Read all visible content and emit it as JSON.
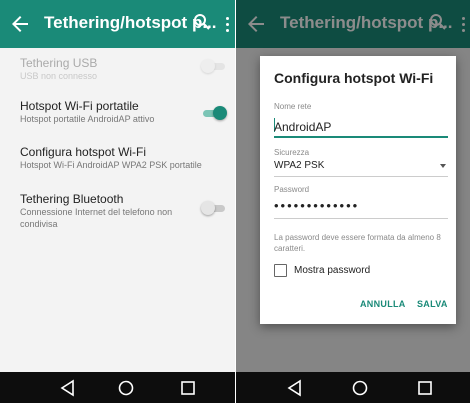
{
  "colors": {
    "accent": "#1a8a78",
    "toolbar": "#1a8a78",
    "nav_bar": "#0d0d0d"
  },
  "left": {
    "toolbar": {
      "title": "Tethering/hotspot p...",
      "back_icon": "arrow-left-icon",
      "search_icon": "search-icon",
      "more_icon": "more-vert-icon"
    },
    "items": [
      {
        "title": "Tethering USB",
        "subtitle": "USB non connesso",
        "toggle_on": false,
        "disabled": true
      },
      {
        "title": "Hotspot Wi-Fi portatile",
        "subtitle": "Hotspot portatile AndroidAP attivo",
        "toggle_on": true,
        "disabled": false
      },
      {
        "title": "Configura hotspot Wi-Fi",
        "subtitle": "Hotspot Wi-Fi AndroidAP WPA2 PSK portatile"
      },
      {
        "title": "Tethering Bluetooth",
        "subtitle": "Connessione Internet del telefono non condivisa",
        "toggle_on": false,
        "disabled": false
      }
    ]
  },
  "right": {
    "toolbar": {
      "title": "Tethering/hotspot p..."
    }
  },
  "dialog": {
    "title": "Configura hotspot Wi-Fi",
    "network_name_label": "Nome rete",
    "network_name_value": "AndroidAP",
    "security_label": "Sicurezza",
    "security_value": "WPA2 PSK",
    "password_label": "Password",
    "password_value": "•••••••••••••",
    "password_hint": "La password deve essere formata da almeno 8 caratteri.",
    "show_password_label": "Mostra password",
    "show_password_checked": false,
    "cancel_label": "ANNULLA",
    "save_label": "SALVA"
  },
  "nav_bar": {
    "icons": [
      "back-triangle-icon",
      "home-circle-icon",
      "recents-square-icon"
    ]
  }
}
